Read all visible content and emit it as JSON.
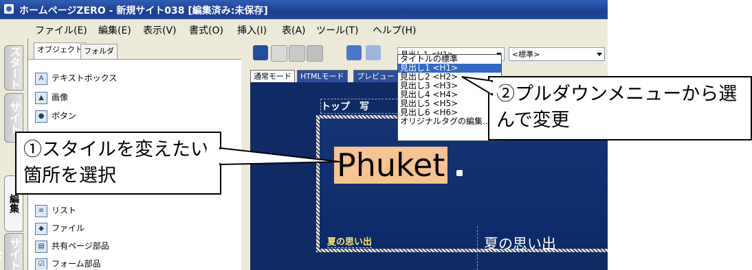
{
  "window": {
    "title": "ホームページZERO - 新規サイト038 [編集済み:未保存]"
  },
  "menu": [
    "ファイル(E)",
    "編集(E)",
    "表示(V)",
    "書式(O)",
    "挿入(I)",
    "表(A)",
    "ツール(T)",
    "ヘルプ(H)"
  ],
  "side_tabs": [
    "スタート",
    "サイト",
    "編集",
    "サイト公"
  ],
  "panel": {
    "tabs": [
      "オブジェクト",
      "フォルダ"
    ],
    "items_top": [
      "テキストボックス",
      "画像",
      "ボタン"
    ],
    "items_bottom": [
      "リスト",
      "ファイル",
      "共有ページ部品",
      "フォーム部品"
    ]
  },
  "toolbar": {
    "heading_combo": "見出し1 <H1>",
    "style_combo": "<標準>",
    "icons": [
      "save-icon",
      "cut-icon",
      "copy-icon",
      "paste-icon",
      "undo-icon",
      "redo-icon"
    ]
  },
  "mode_tabs": [
    "通常モード",
    "HTMLモード",
    "プレビュー"
  ],
  "dropdown_options": [
    "タイトルの標準",
    "見出し1 <H1>",
    "見出し2 <H2>",
    "見出し3 <H3>",
    "見出し4 <H4>",
    "見出し5 <H5>",
    "見出し6 <H6>",
    "オリジナルタグの編集..."
  ],
  "dropdown_selected_index": 1,
  "canvas": {
    "nav_text": "トップ　写",
    "heading_text": "Phuket",
    "sub_left": "夏の思い出",
    "sub_right": "夏の思い出"
  },
  "callouts": {
    "left": "①スタイルを変えたい箇所を選択",
    "right": "②プルダウンメニューから選んで変更"
  },
  "colors": {
    "title_bar": "#1b3f8f",
    "canvas_bg": "#0e2b63",
    "selection": "#316ac5",
    "heading_highlight": "#f8c38e"
  }
}
